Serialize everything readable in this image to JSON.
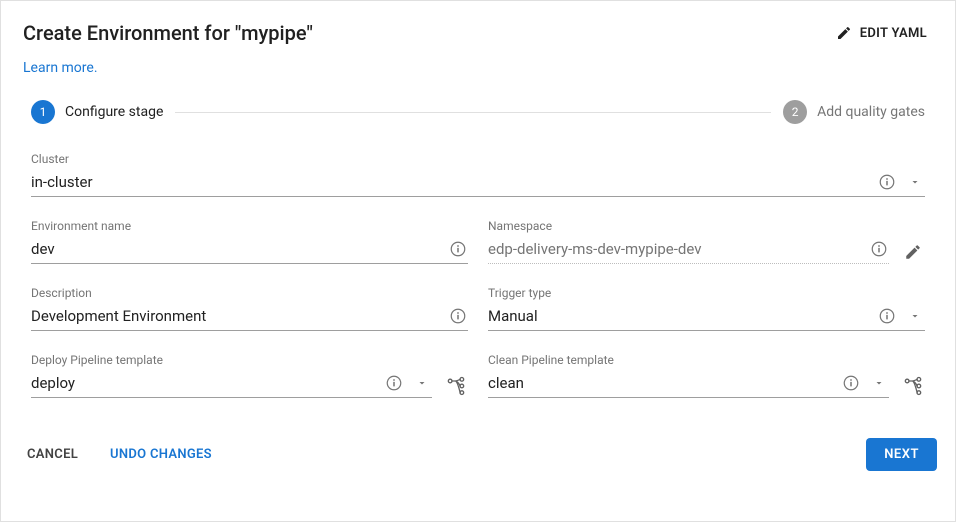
{
  "header": {
    "title": "Create Environment for \"mypipe\"",
    "edit_yaml": "EDIT YAML",
    "learn_more": "Learn more."
  },
  "stepper": {
    "step1_num": "1",
    "step1_label": "Configure stage",
    "step2_num": "2",
    "step2_label": "Add quality gates"
  },
  "form": {
    "cluster": {
      "label": "Cluster",
      "value": "in-cluster"
    },
    "env_name": {
      "label": "Environment name",
      "value": "dev"
    },
    "namespace": {
      "label": "Namespace",
      "value": "edp-delivery-ms-dev-mypipe-dev"
    },
    "description": {
      "label": "Description",
      "value": "Development Environment"
    },
    "trigger_type": {
      "label": "Trigger type",
      "value": "Manual"
    },
    "deploy_tpl": {
      "label": "Deploy Pipeline template",
      "value": "deploy"
    },
    "clean_tpl": {
      "label": "Clean Pipeline template",
      "value": "clean"
    }
  },
  "footer": {
    "cancel": "CANCEL",
    "undo": "UNDO CHANGES",
    "next": "NEXT"
  }
}
